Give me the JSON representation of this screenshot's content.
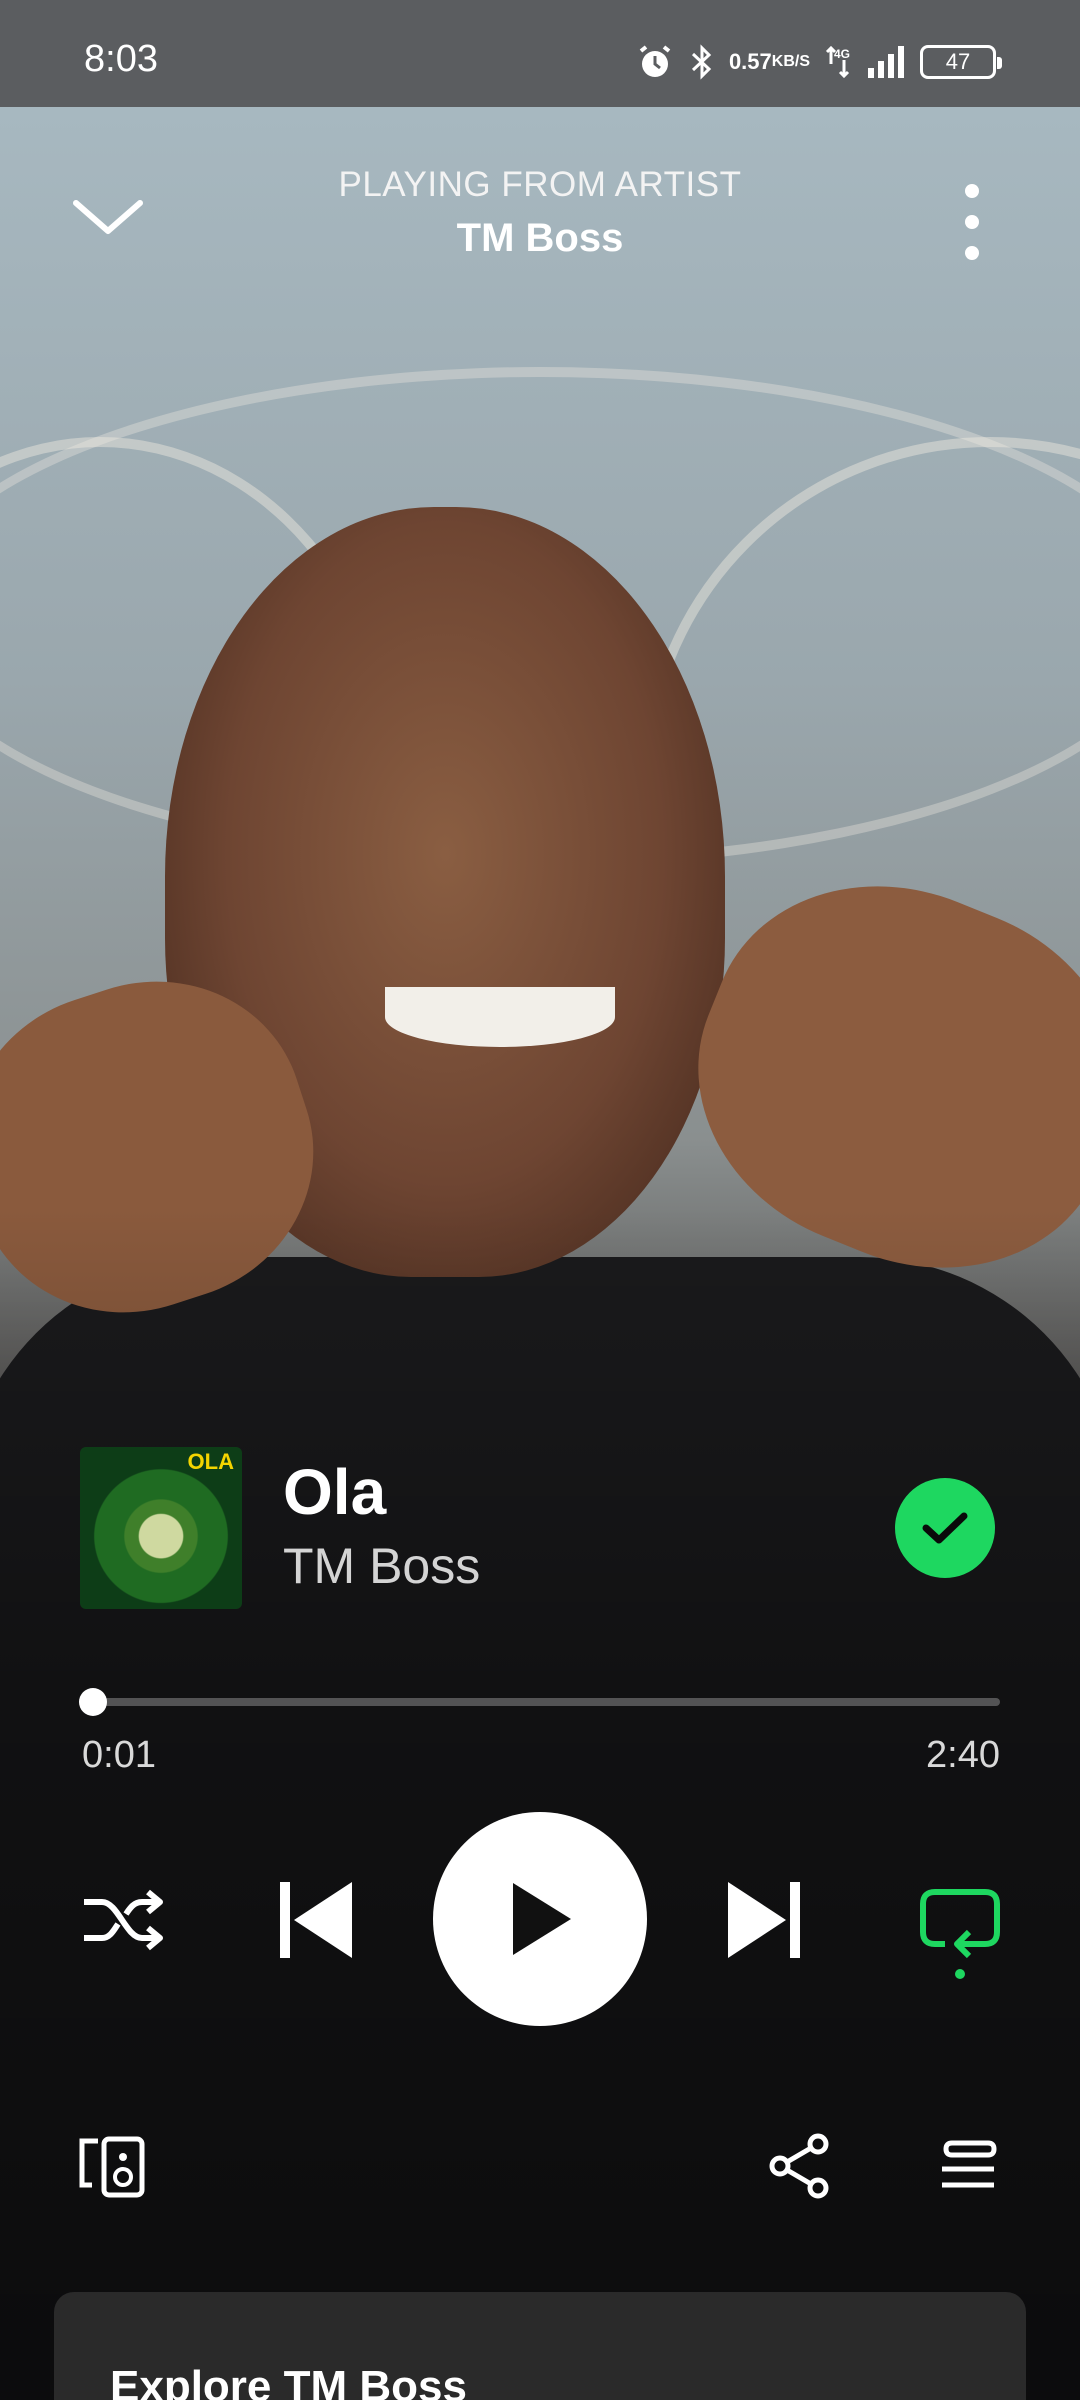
{
  "status_bar": {
    "time": "8:03",
    "net_speed_value": "0.57",
    "net_speed_unit": "KB/S",
    "network": "4G",
    "battery": "47",
    "icons": [
      "alarm-icon",
      "bluetooth-icon",
      "data-arrows-icon",
      "signal-icon",
      "battery-icon"
    ]
  },
  "header": {
    "context_label": "PLAYING FROM ARTIST",
    "context_name": "TM Boss",
    "icons": [
      "chevron-down-icon",
      "more-vertical-icon"
    ]
  },
  "track": {
    "cover_text": "OLA",
    "title": "Ola",
    "artist": "TM Boss",
    "liked": true
  },
  "progress": {
    "current": "0:01",
    "total": "2:40",
    "fraction": 0.006
  },
  "controls": {
    "shuffle": "shuffle-icon",
    "previous": "skip-previous-icon",
    "play": "play-icon",
    "next": "skip-next-icon",
    "repeat": "repeat-icon"
  },
  "bottom_bar": {
    "devices": "connect-devices-icon",
    "share": "share-icon",
    "queue": "queue-icon"
  },
  "explore": {
    "title": "Explore TM Boss"
  },
  "colors": {
    "accent": "#1ed760",
    "status_bar": "#5b5d60",
    "card": "#2a2a2a"
  }
}
